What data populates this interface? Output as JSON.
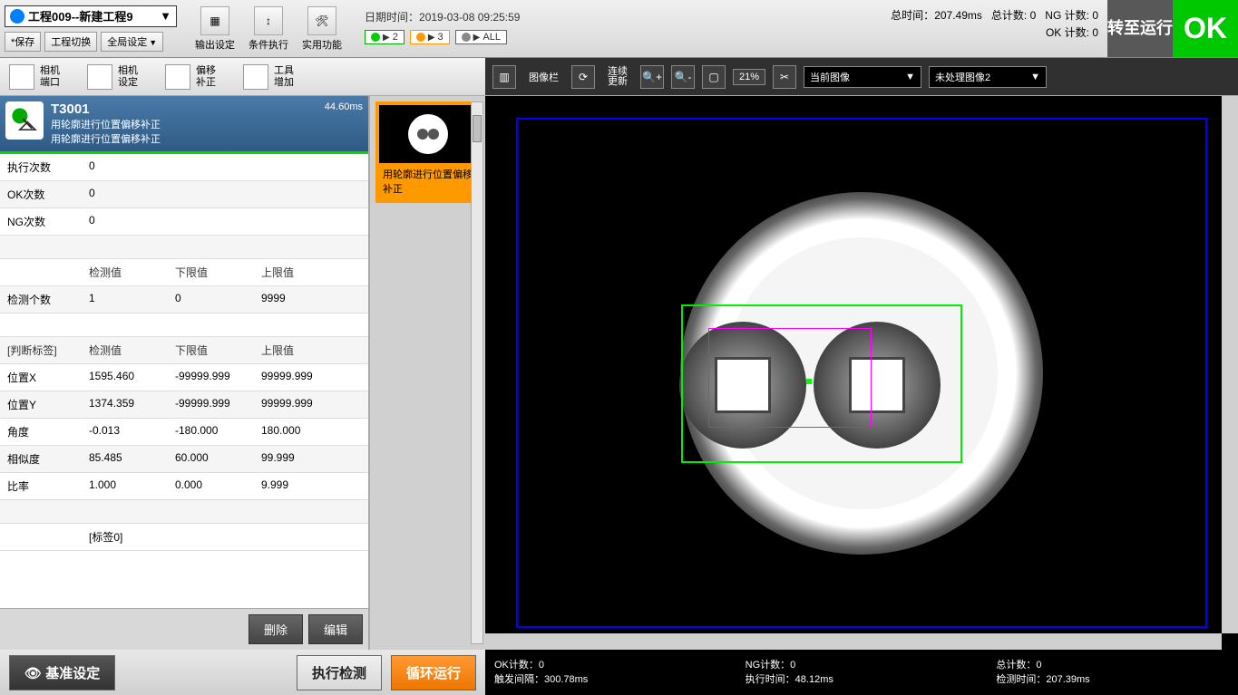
{
  "top": {
    "project": "工程009--新建工程9",
    "save": "*保存",
    "switch": "工程切换",
    "global": "全局设定",
    "tools": {
      "output": "输出设定",
      "condition": "条件执行",
      "utility": "实用功能"
    },
    "datetime_label": "日期时间：",
    "datetime": "2019-03-08 09:25:59",
    "badges": {
      "b2": "2",
      "b3": "3",
      "ball": "ALL"
    },
    "stats": {
      "total_time_label": "总时间：",
      "total_time": "207.49ms",
      "total_count_label": "总计数:",
      "total_count": "0",
      "ng_label": "NG 计数:",
      "ng": "0",
      "ok_label": "OK 计数:",
      "ok": "0"
    },
    "run_btn": "转至运行",
    "ok_btn": "OK"
  },
  "tb2": {
    "cam_port": "相机\n端口",
    "cam_set": "相机\n设定",
    "offset": "偏移\n补正",
    "tool_add": "工具\n增加",
    "img_bar": "图像栏",
    "cont_update": "连续\n更新",
    "zoom": "21%",
    "sel1": "当前图像",
    "sel2": "未处理图像2"
  },
  "tool": {
    "id": "T3001",
    "line1": "用轮廓进行位置偏移补正",
    "line2": "用轮廓进行位置偏移补正",
    "time": "44.60ms"
  },
  "thumb": {
    "label": "用轮廓进行位置偏移补正"
  },
  "rows": {
    "exec_label": "执行次数",
    "exec_val": "0",
    "ok_label": "OK次数",
    "ok_val": "0",
    "ng_label": "NG次数",
    "ng_val": "0",
    "hdr_det": "检测值",
    "hdr_low": "下限值",
    "hdr_hi": "上限值",
    "detcnt_label": "检测个数",
    "detcnt_v": "1",
    "detcnt_lo": "0",
    "detcnt_hi": "9999",
    "judge_label": "[判断标签]",
    "posx_label": "位置X",
    "posx_v": "1595.460",
    "posx_lo": "-99999.999",
    "posx_hi": "99999.999",
    "posy_label": "位置Y",
    "posy_v": "1374.359",
    "posy_lo": "-99999.999",
    "posy_hi": "99999.999",
    "ang_label": "角度",
    "ang_v": "-0.013",
    "ang_lo": "-180.000",
    "ang_hi": "180.000",
    "sim_label": "相似度",
    "sim_v": "85.485",
    "sim_lo": "60.000",
    "sim_hi": "99.999",
    "ratio_label": "比率",
    "ratio_v": "1.000",
    "ratio_lo": "0.000",
    "ratio_hi": "9.999",
    "tag0": "[标签0]"
  },
  "actions": {
    "delete": "删除",
    "edit": "编辑"
  },
  "bottom_left": {
    "base": "基准设定",
    "exec": "执行检测",
    "loop": "循环运行"
  },
  "bottom_stats": {
    "ok_cnt_l": "OK计数：",
    "ok_cnt": "0",
    "trig_l": "触发间隔：",
    "trig": "300.78ms",
    "ng_cnt_l": "NG计数：",
    "ng_cnt": "0",
    "exec_l": "执行时间：",
    "exec": "48.12ms",
    "tot_l": "总计数：",
    "tot": "0",
    "det_l": "检测时间：",
    "det": "207.39ms"
  }
}
